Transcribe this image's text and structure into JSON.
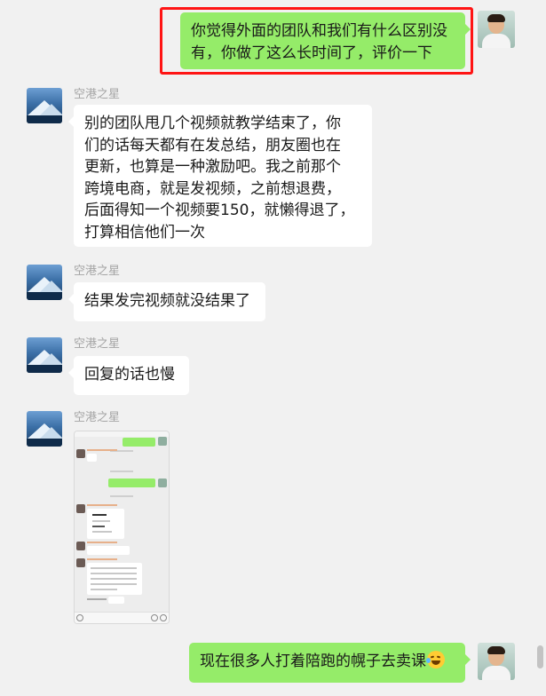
{
  "contact": {
    "name": "空港之星"
  },
  "messages": {
    "m1": {
      "line1": "你觉得外面的团队和我们有什么区别没",
      "line2": "有，你做了这么长时间了，评价一下"
    },
    "m2": {
      "sender": "空港之星",
      "line1": "别的团队甩几个视频就教学结束了，你",
      "line2": "们的话每天都有在发总结，朋友圈也在",
      "line3": "更新，也算是一种激励吧。我之前那个",
      "line4": "跨境电商，就是发视频，之前想退费，",
      "line5": "后面得知一个视频要150，就懒得退了，",
      "line6": "打算相信他们一次"
    },
    "m3": {
      "sender": "空港之星",
      "text": "结果发完视频就没结果了"
    },
    "m4": {
      "sender": "空港之星",
      "text": "回复的话也慢"
    },
    "m5": {
      "sender": "空港之星",
      "image_icon": "chat-screenshot-thumbnail"
    },
    "m6": {
      "text": "现在很多人打着陪跑的幌子去卖课",
      "emoji": "laughing-crying-emoji"
    }
  },
  "colors": {
    "self_bubble": "#95ec69",
    "other_bubble": "#ffffff",
    "background": "#f1f1f1",
    "highlight": "#ff1414"
  }
}
